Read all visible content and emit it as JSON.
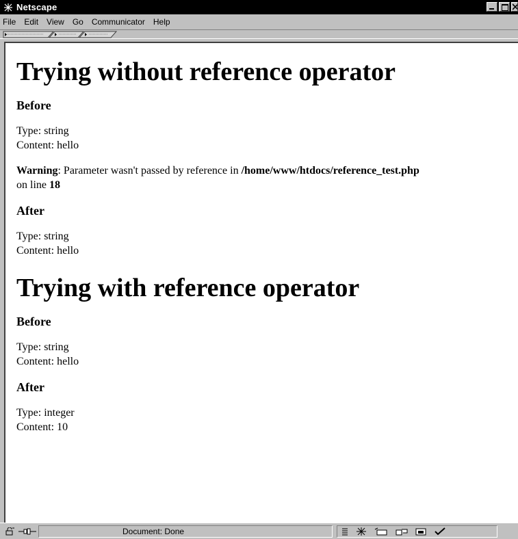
{
  "window": {
    "title": "Netscape"
  },
  "menu": {
    "items": [
      {
        "label": "File"
      },
      {
        "label": "Edit"
      },
      {
        "label": "View"
      },
      {
        "label": "Go"
      },
      {
        "label": "Communicator"
      },
      {
        "label": "Help"
      }
    ]
  },
  "page": {
    "section1": {
      "heading": "Trying without reference operator",
      "before_heading": "Before",
      "before_type": "Type: string",
      "before_content": "Content: hello",
      "warning_label": "Warning",
      "warning_text": ": Parameter wasn't passed by reference in ",
      "warning_path": "/home/www/htdocs/reference_test.php",
      "warning_line_prefix": "on line ",
      "warning_line_number": "18",
      "after_heading": "After",
      "after_type": "Type: string",
      "after_content": "Content: hello"
    },
    "section2": {
      "heading": "Trying with reference operator",
      "before_heading": "Before",
      "before_type": "Type: string",
      "before_content": "Content: hello",
      "after_heading": "After",
      "after_type": "Type: integer",
      "after_content": "Content: 10"
    }
  },
  "statusbar": {
    "status_text": "Document: Done",
    "icons": [
      "security-lock-icon",
      "connection-icon",
      "navigator-icon",
      "mail-icon",
      "discussion-icon",
      "composer-icon",
      "spellcheck-icon"
    ]
  }
}
